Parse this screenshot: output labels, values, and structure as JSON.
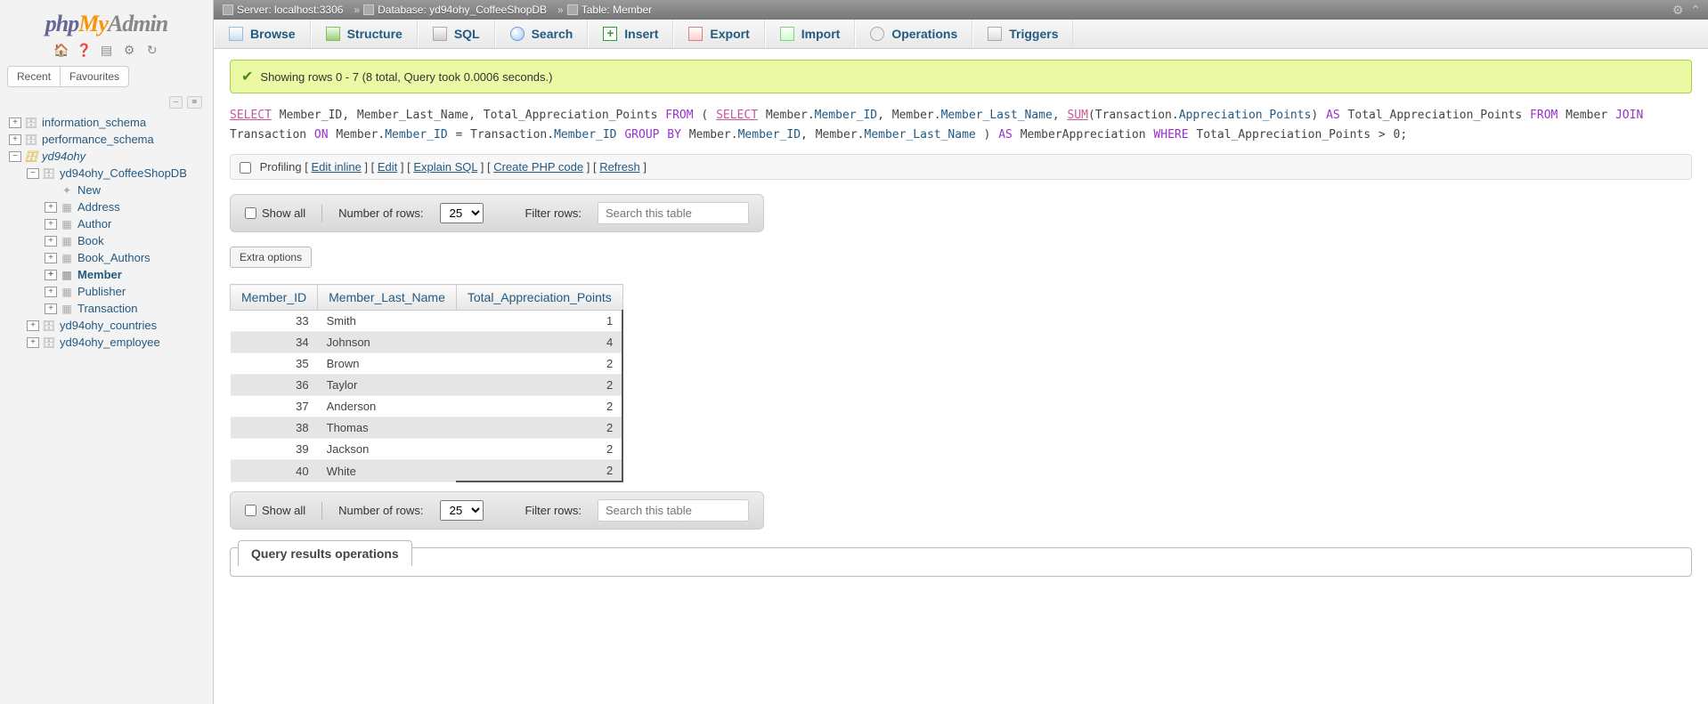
{
  "logo": {
    "part1": "php",
    "part2": "My",
    "part3": "Admin"
  },
  "sidebar": {
    "tabs": {
      "recent": "Recent",
      "favourites": "Favourites"
    },
    "tree": [
      {
        "level": 1,
        "expand": "+",
        "icon": "db",
        "label": "information_schema",
        "active": false
      },
      {
        "level": 1,
        "expand": "+",
        "icon": "db",
        "label": "performance_schema",
        "active": false
      },
      {
        "level": 1,
        "expand": "−",
        "icon": "db",
        "label": "yd94ohy",
        "active": false,
        "italic": true,
        "yellow": true
      },
      {
        "level": 2,
        "expand": "−",
        "icon": "db",
        "label": "yd94ohy_CoffeeShopDB",
        "active": false
      },
      {
        "level": 3,
        "expand": "",
        "icon": "new",
        "label": "New",
        "active": false
      },
      {
        "level": 3,
        "expand": "+",
        "icon": "tbl",
        "label": "Address",
        "active": false
      },
      {
        "level": 3,
        "expand": "+",
        "icon": "tbl",
        "label": "Author",
        "active": false
      },
      {
        "level": 3,
        "expand": "+",
        "icon": "tbl",
        "label": "Book",
        "active": false
      },
      {
        "level": 3,
        "expand": "+",
        "icon": "tbl",
        "label": "Book_Authors",
        "active": false
      },
      {
        "level": 3,
        "expand": "+",
        "icon": "tbl",
        "label": "Member",
        "active": true
      },
      {
        "level": 3,
        "expand": "+",
        "icon": "tbl",
        "label": "Publisher",
        "active": false
      },
      {
        "level": 3,
        "expand": "+",
        "icon": "tbl",
        "label": "Transaction",
        "active": false
      },
      {
        "level": 2,
        "expand": "+",
        "icon": "db",
        "label": "yd94ohy_countries",
        "active": false
      },
      {
        "level": 2,
        "expand": "+",
        "icon": "db",
        "label": "yd94ohy_employee",
        "active": false
      }
    ]
  },
  "breadcrumb": {
    "server_label": "Server:",
    "server": "localhost:3306",
    "database_label": "Database:",
    "database": "yd94ohy_CoffeeShopDB",
    "table_label": "Table:",
    "table": "Member"
  },
  "tabs": [
    {
      "icon": "ic-browse",
      "label": "Browse",
      "name": "tab-browse"
    },
    {
      "icon": "ic-struct",
      "label": "Structure",
      "name": "tab-structure"
    },
    {
      "icon": "ic-sql",
      "label": "SQL",
      "name": "tab-sql"
    },
    {
      "icon": "ic-search",
      "label": "Search",
      "name": "tab-search"
    },
    {
      "icon": "ic-insert",
      "label": "Insert",
      "name": "tab-insert"
    },
    {
      "icon": "ic-export",
      "label": "Export",
      "name": "tab-export"
    },
    {
      "icon": "ic-import",
      "label": "Import",
      "name": "tab-import"
    },
    {
      "icon": "ic-ops",
      "label": "Operations",
      "name": "tab-operations"
    },
    {
      "icon": "ic-trig",
      "label": "Triggers",
      "name": "tab-triggers"
    }
  ],
  "success_msg": "Showing rows 0 - 7 (8 total, Query took 0.0006 seconds.)",
  "sql": {
    "select1": "SELECT",
    "cols1": " Member_ID, Member_Last_Name, Total_Appreciation_Points ",
    "from1": "FROM",
    "open": " ( ",
    "select2": "SELECT",
    "m1": " Member.",
    "mid": "Member_ID",
    "c1": ", Member.",
    "mln": "Member_Last_Name",
    "c2": ", ",
    "sum": "SUM",
    "sumarg": "(Transaction.",
    "ap": "Appreciation_Points",
    "close1": ") ",
    "as1": "AS",
    "tap": " Total_Appreciation_Points ",
    "from2": "FROM",
    "mem": " Member ",
    "join": "JOIN",
    "tx": " Transaction ",
    "on": "ON",
    "onclause1": " Member.",
    "mid2": "Member_ID",
    "eq": " = Transaction.",
    "mid3": "Member_ID",
    "gb": " GROUP BY",
    "gbcols": " Member.",
    "mid4": "Member_ID",
    "c3": ", Member.",
    "mln2": "Member_Last_Name",
    "close2": " ) ",
    "as2": "AS",
    "alias": " MemberAppreciation ",
    "where": "WHERE",
    "wc": " Total_Appreciation_Points > 0;"
  },
  "query_links": {
    "profiling": "Profiling",
    "edit_inline": "Edit inline",
    "edit": "Edit",
    "explain": "Explain SQL",
    "php": "Create PHP code",
    "refresh": "Refresh"
  },
  "controls": {
    "show_all": "Show all",
    "num_rows": "Number of rows:",
    "row_options": [
      "25"
    ],
    "selected_rows": "25",
    "filter_label": "Filter rows:",
    "filter_placeholder": "Search this table"
  },
  "extra_options": "Extra options",
  "table": {
    "headers": [
      "Member_ID",
      "Member_Last_Name",
      "Total_Appreciation_Points"
    ],
    "rows": [
      {
        "id": "33",
        "name": "Smith",
        "pts": "1"
      },
      {
        "id": "34",
        "name": "Johnson",
        "pts": "4"
      },
      {
        "id": "35",
        "name": "Brown",
        "pts": "2"
      },
      {
        "id": "36",
        "name": "Taylor",
        "pts": "2"
      },
      {
        "id": "37",
        "name": "Anderson",
        "pts": "2"
      },
      {
        "id": "38",
        "name": "Thomas",
        "pts": "2"
      },
      {
        "id": "39",
        "name": "Jackson",
        "pts": "2"
      },
      {
        "id": "40",
        "name": "White",
        "pts": "2"
      }
    ]
  },
  "results_ops": "Query results operations"
}
